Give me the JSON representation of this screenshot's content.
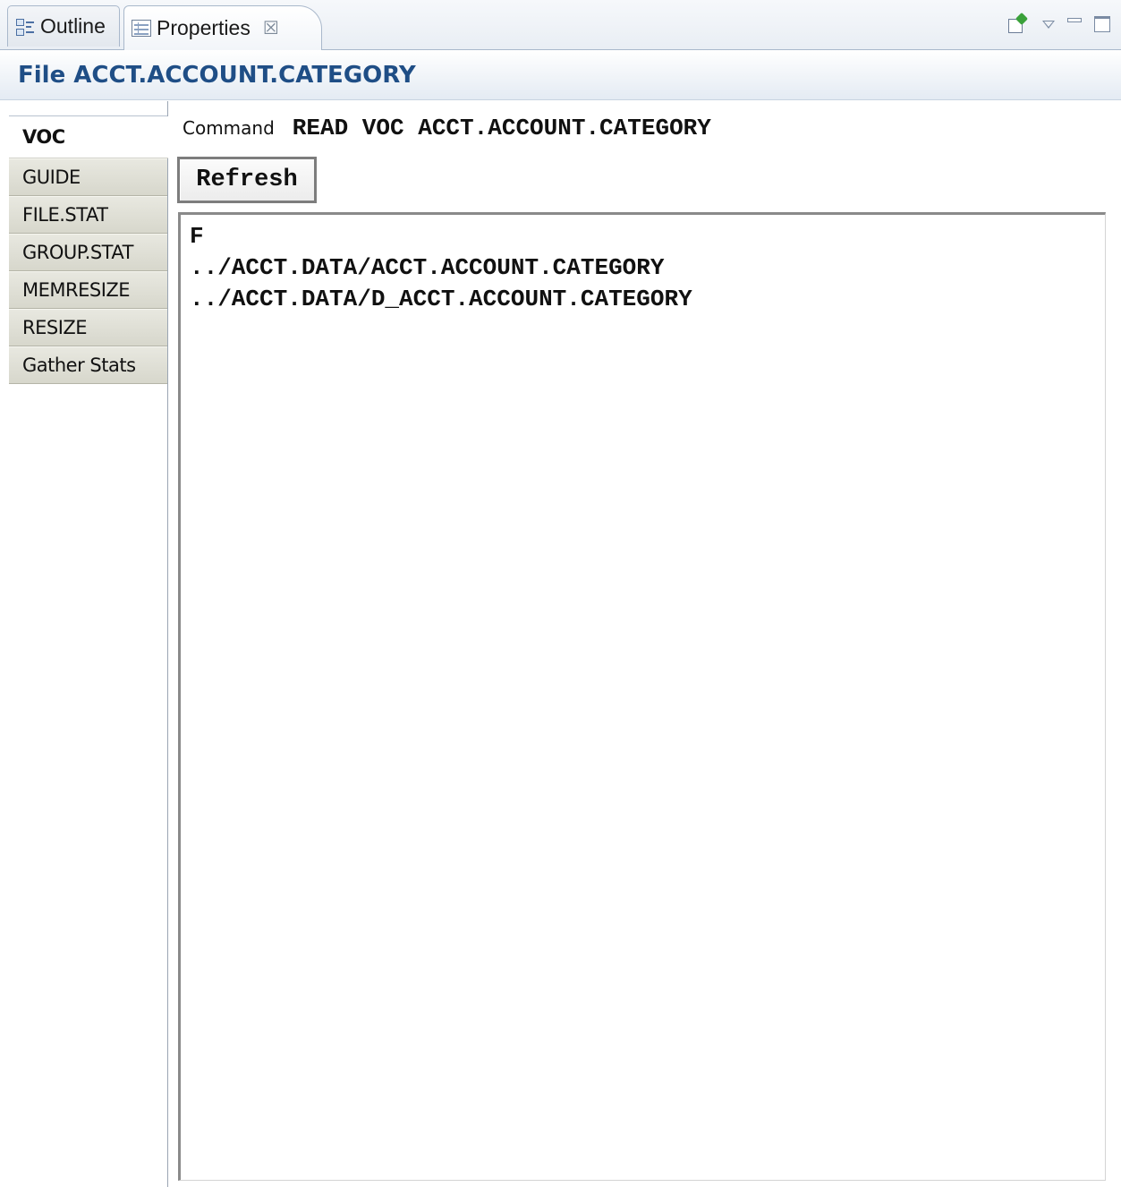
{
  "tabs": [
    {
      "label": "Outline",
      "icon": "outline-icon",
      "active": false
    },
    {
      "label": "Properties",
      "icon": "properties-icon",
      "active": true,
      "close_glyph": "☒"
    }
  ],
  "view_actions": [
    "pin-icon",
    "view-menu-icon",
    "minimize-icon",
    "maximize-icon"
  ],
  "page_title": "File ACCT.ACCOUNT.CATEGORY",
  "property_tabs": [
    {
      "label": "VOC",
      "selected": true
    },
    {
      "label": "GUIDE",
      "selected": false
    },
    {
      "label": "FILE.STAT",
      "selected": false
    },
    {
      "label": "GROUP.STAT",
      "selected": false
    },
    {
      "label": "MEMRESIZE",
      "selected": false
    },
    {
      "label": "RESIZE",
      "selected": false
    },
    {
      "label": "Gather Stats",
      "selected": false
    }
  ],
  "command": {
    "label": "Command",
    "value": "READ VOC ACCT.ACCOUNT.CATEGORY"
  },
  "refresh_label": "Refresh",
  "output_lines": [
    "F",
    "../ACCT.DATA/ACCT.ACCOUNT.CATEGORY",
    "../ACCT.DATA/D_ACCT.ACCOUNT.CATEGORY"
  ],
  "colors": {
    "title_text": "#1f4e86",
    "tab_background": "#e9eef4",
    "property_tab_background": "#dcdcd2"
  }
}
